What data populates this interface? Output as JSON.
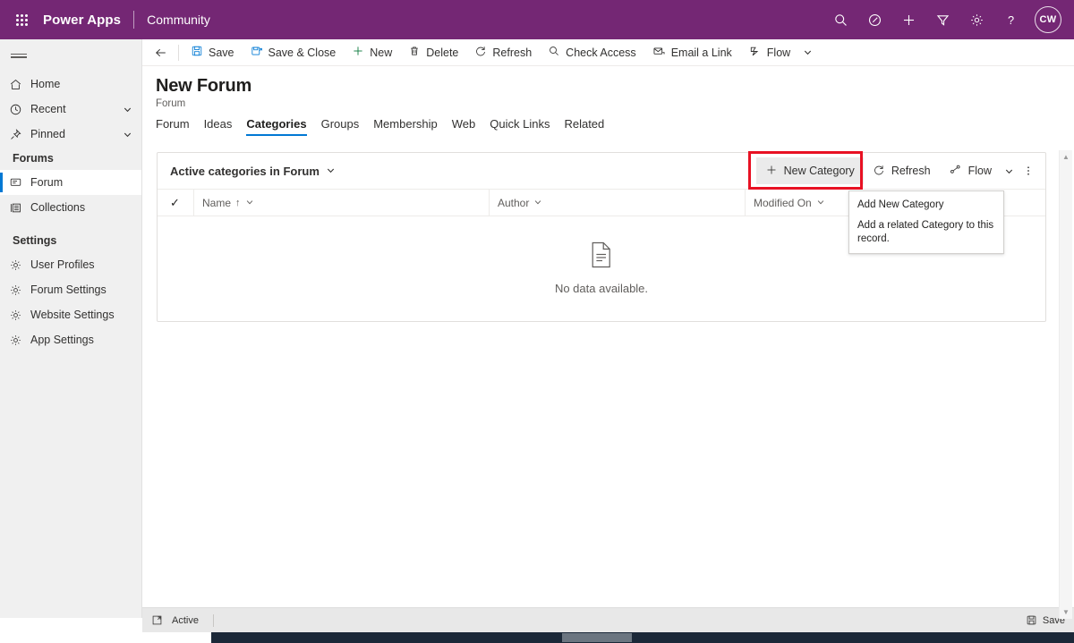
{
  "topbar": {
    "waffle_label": "App launcher",
    "brand": "Power Apps",
    "app_name": "Community",
    "icons": [
      {
        "name": "search-icon",
        "label": "Search"
      },
      {
        "name": "diagnostics-icon",
        "label": "Diagnostics"
      },
      {
        "name": "plus-icon",
        "label": "New"
      },
      {
        "name": "filter-icon",
        "label": "Filter"
      },
      {
        "name": "gear-icon",
        "label": "Settings"
      },
      {
        "name": "help-icon",
        "label": "Help"
      }
    ],
    "avatar_initials": "CW"
  },
  "sidebar": {
    "items": [
      {
        "label": "Home",
        "icon": "home-icon",
        "chevron": false,
        "selected": false
      },
      {
        "label": "Recent",
        "icon": "clock-icon",
        "chevron": true,
        "selected": false
      },
      {
        "label": "Pinned",
        "icon": "pin-icon",
        "chevron": true,
        "selected": false
      }
    ],
    "group_forums": "Forums",
    "forums_items": [
      {
        "label": "Forum",
        "icon": "forum-icon",
        "selected": true
      },
      {
        "label": "Collections",
        "icon": "collections-icon",
        "selected": false
      }
    ],
    "group_settings": "Settings",
    "settings_items": [
      {
        "label": "User Profiles",
        "icon": "gear-icon"
      },
      {
        "label": "Forum Settings",
        "icon": "gear-icon"
      },
      {
        "label": "Website Settings",
        "icon": "gear-icon"
      },
      {
        "label": "App Settings",
        "icon": "gear-icon"
      }
    ]
  },
  "commandbar": {
    "back_label": "Back",
    "buttons": [
      {
        "label": "Save",
        "icon": "save-icon"
      },
      {
        "label": "Save & Close",
        "icon": "save-close-icon"
      },
      {
        "label": "New",
        "icon": "plus-icon"
      },
      {
        "label": "Delete",
        "icon": "trash-icon"
      },
      {
        "label": "Refresh",
        "icon": "refresh-icon"
      },
      {
        "label": "Check Access",
        "icon": "check-access-icon"
      },
      {
        "label": "Email a Link",
        "icon": "email-link-icon"
      },
      {
        "label": "Flow",
        "icon": "flow-icon"
      }
    ]
  },
  "record": {
    "title": "New Forum",
    "subtitle": "Forum",
    "tabs": [
      {
        "label": "Forum",
        "active": false
      },
      {
        "label": "Ideas",
        "active": false
      },
      {
        "label": "Categories",
        "active": true
      },
      {
        "label": "Groups",
        "active": false
      },
      {
        "label": "Membership",
        "active": false
      },
      {
        "label": "Web",
        "active": false
      },
      {
        "label": "Quick Links",
        "active": false
      },
      {
        "label": "Related",
        "active": false
      }
    ]
  },
  "subgrid": {
    "view_name": "Active categories in Forum",
    "actions": {
      "new_category": "New Category",
      "refresh": "Refresh",
      "flow": "Flow",
      "more": "More commands"
    },
    "columns": [
      {
        "label": "Name",
        "sorted": true,
        "sort_glyph": "↑"
      },
      {
        "label": "Author",
        "sorted": false,
        "sort_glyph": ""
      },
      {
        "label": "Modified On",
        "sorted": false,
        "sort_glyph": ""
      }
    ],
    "select_all_glyph": "✓",
    "empty_message": "No data available.",
    "rows": []
  },
  "callout": {
    "title": "Add New Category",
    "description": "Add a related Category to this record."
  },
  "footer": {
    "status": "Active",
    "save_label": "Save",
    "expand_icon": "expand-icon",
    "save_icon": "save-icon"
  },
  "colors": {
    "brand_purple": "#742774",
    "accent_blue": "#0078d4",
    "highlight_red": "#e81123",
    "sidebar_bg": "#f0f0f0"
  }
}
